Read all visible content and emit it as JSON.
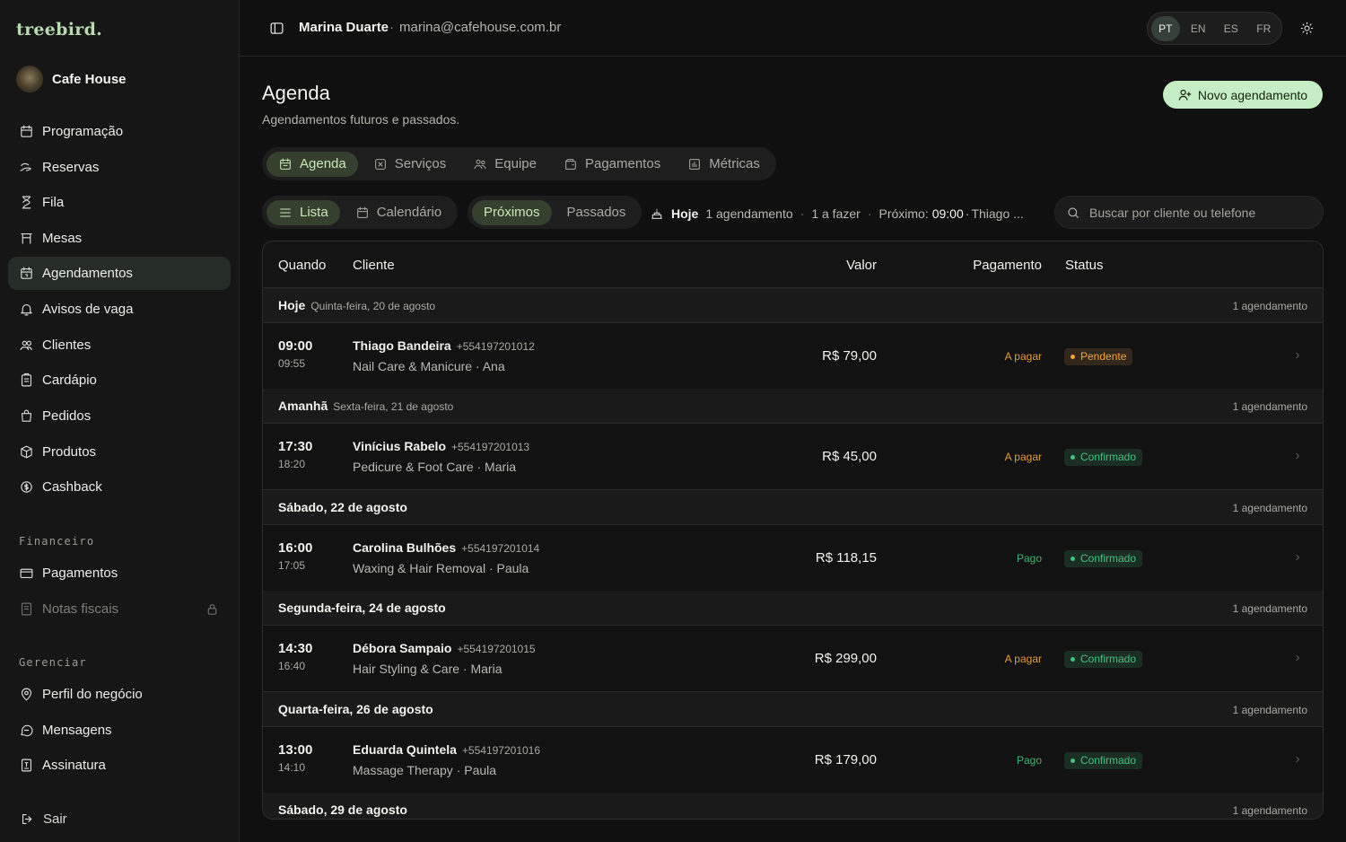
{
  "brand": "treebird.",
  "business": {
    "name": "Cafe House"
  },
  "sidebar": {
    "main": [
      {
        "label": "Programação",
        "icon": "calendar-icon"
      },
      {
        "label": "Reservas",
        "icon": "hand-icon"
      },
      {
        "label": "Fila",
        "icon": "hourglass-icon"
      },
      {
        "label": "Mesas",
        "icon": "table-icon"
      },
      {
        "label": "Agendamentos",
        "icon": "calendar-clock-icon",
        "active": true
      },
      {
        "label": "Avisos de vaga",
        "icon": "bell-icon"
      },
      {
        "label": "Clientes",
        "icon": "users-icon"
      },
      {
        "label": "Cardápio",
        "icon": "menu-book-icon"
      },
      {
        "label": "Pedidos",
        "icon": "bag-icon"
      },
      {
        "label": "Produtos",
        "icon": "package-icon"
      },
      {
        "label": "Cashback",
        "icon": "coin-icon"
      }
    ],
    "financeiro_label": "Financeiro",
    "financeiro": [
      {
        "label": "Pagamentos",
        "icon": "card-icon"
      },
      {
        "label": "Notas fiscais",
        "icon": "receipt-icon",
        "locked": true
      }
    ],
    "gerenciar_label": "Gerenciar",
    "gerenciar": [
      {
        "label": "Perfil do negócio",
        "icon": "pin-icon"
      },
      {
        "label": "Mensagens",
        "icon": "chat-icon"
      },
      {
        "label": "Assinatura",
        "icon": "document-icon"
      }
    ],
    "logout": "Sair"
  },
  "topbar": {
    "user_name": "Marina Duarte",
    "separator": "·",
    "user_email": "marina@cafehouse.com.br",
    "languages": [
      "PT",
      "EN",
      "ES",
      "FR"
    ],
    "active_language": "PT"
  },
  "page": {
    "title": "Agenda",
    "subtitle": "Agendamentos futuros e passados.",
    "new_button": "Novo agendamento"
  },
  "tabs": [
    {
      "label": "Agenda",
      "icon": "calendar-icon",
      "active": true
    },
    {
      "label": "Serviços",
      "icon": "scissors-icon"
    },
    {
      "label": "Equipe",
      "icon": "team-icon"
    },
    {
      "label": "Pagamentos",
      "icon": "wallet-icon"
    },
    {
      "label": "Métricas",
      "icon": "chart-icon"
    }
  ],
  "view_toggle": [
    {
      "label": "Lista",
      "icon": "list-icon",
      "active": true
    },
    {
      "label": "Calendário",
      "icon": "calendar-icon"
    }
  ],
  "period_toggle": [
    {
      "label": "Próximos",
      "active": true
    },
    {
      "label": "Passados"
    }
  ],
  "summary": {
    "today": "Hoje",
    "count": "1 agendamento",
    "todo": "1 a fazer",
    "next_label": "Próximo:",
    "next_time": "09:00",
    "next_client": "Thiago ..."
  },
  "search": {
    "placeholder": "Buscar por cliente ou telefone"
  },
  "table": {
    "headers": {
      "when": "Quando",
      "client": "Cliente",
      "value": "Valor",
      "payment": "Pagamento",
      "status": "Status"
    },
    "groups": [
      {
        "title": "Hoje",
        "date": "Quinta-feira, 20 de agosto",
        "count": "1 agendamento",
        "rows": [
          {
            "start": "09:00",
            "end": "09:55",
            "client": "Thiago Bandeira",
            "phone": "+554197201012",
            "service": "Nail Care & Manicure · Ana",
            "value": "R$ 79,00",
            "payment": "A pagar",
            "payment_state": "due",
            "status": "Pendente",
            "status_state": "pending"
          }
        ]
      },
      {
        "title": "Amanhã",
        "date": "Sexta-feira, 21 de agosto",
        "count": "1 agendamento",
        "rows": [
          {
            "start": "17:30",
            "end": "18:20",
            "client": "Vinícius Rabelo",
            "phone": "+554197201013",
            "service": "Pedicure & Foot Care · Maria",
            "value": "R$ 45,00",
            "payment": "A pagar",
            "payment_state": "due",
            "status": "Confirmado",
            "status_state": "confirmed"
          }
        ]
      },
      {
        "title": "Sábado, 22 de agosto",
        "date": "",
        "count": "1 agendamento",
        "rows": [
          {
            "start": "16:00",
            "end": "17:05",
            "client": "Carolina Bulhões",
            "phone": "+554197201014",
            "service": "Waxing & Hair Removal · Paula",
            "value": "R$ 118,15",
            "payment": "Pago",
            "payment_state": "paid",
            "status": "Confirmado",
            "status_state": "confirmed"
          }
        ]
      },
      {
        "title": "Segunda-feira, 24 de agosto",
        "date": "",
        "count": "1 agendamento",
        "rows": [
          {
            "start": "14:30",
            "end": "16:40",
            "client": "Débora Sampaio",
            "phone": "+554197201015",
            "service": "Hair Styling & Care · Maria",
            "value": "R$ 299,00",
            "payment": "A pagar",
            "payment_state": "due",
            "status": "Confirmado",
            "status_state": "confirmed"
          }
        ]
      },
      {
        "title": "Quarta-feira, 26 de agosto",
        "date": "",
        "count": "1 agendamento",
        "rows": [
          {
            "start": "13:00",
            "end": "14:10",
            "client": "Eduarda Quintela",
            "phone": "+554197201016",
            "service": "Massage Therapy · Paula",
            "value": "R$ 179,00",
            "payment": "Pago",
            "payment_state": "paid",
            "status": "Confirmado",
            "status_state": "confirmed"
          }
        ]
      },
      {
        "title": "Sábado, 29 de agosto",
        "date": "",
        "count": "1 agendamento",
        "rows": []
      }
    ]
  }
}
